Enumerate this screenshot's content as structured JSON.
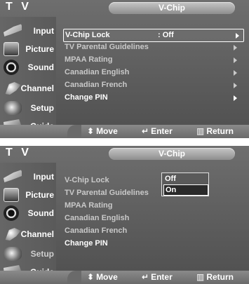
{
  "header": {
    "tv_label": "T V",
    "title": "V-Chip"
  },
  "sidebar": {
    "items": [
      {
        "label": "Input",
        "icon": "input-icon"
      },
      {
        "label": "Picture",
        "icon": "picture-icon"
      },
      {
        "label": "Sound",
        "icon": "sound-icon"
      },
      {
        "label": "Channel",
        "icon": "channel-icon"
      },
      {
        "label": "Setup",
        "icon": "setup-icon"
      },
      {
        "label": "Guide",
        "icon": "guide-icon"
      }
    ]
  },
  "menu": {
    "items": [
      {
        "label": "V-Chip Lock",
        "value": ": Off"
      },
      {
        "label": "TV Parental Guidelines"
      },
      {
        "label": "MPAA Rating"
      },
      {
        "label": "Canadian English"
      },
      {
        "label": "Canadian French"
      },
      {
        "label": "Change PIN"
      }
    ]
  },
  "dropdown": {
    "colon": ":",
    "options": [
      "Off",
      "On"
    ],
    "selected": "On"
  },
  "footer": {
    "move": "Move",
    "enter": "Enter",
    "return": "Return",
    "move_glyph": "⬍",
    "enter_glyph": "↵",
    "return_glyph": "▥"
  }
}
